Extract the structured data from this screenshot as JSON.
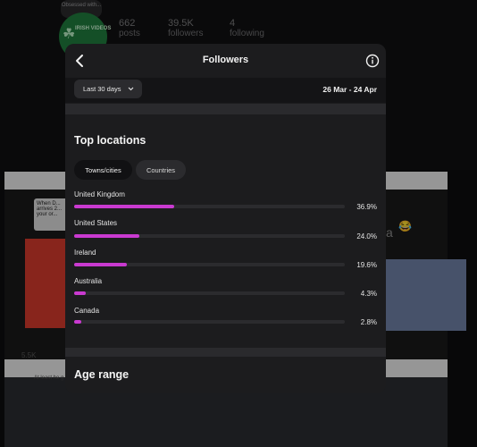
{
  "background": {
    "tag": "Obsessed with...",
    "avatar_label": "IRISH VIDEOS",
    "stats": [
      {
        "value": "662",
        "label": "posts"
      },
      {
        "value": "39.5K",
        "label": "followers"
      },
      {
        "value": "4",
        "label": "following"
      }
    ],
    "speech_text": "When D... arrives 2... your or...",
    "side_letter": "a",
    "side_emoji": "😂",
    "views_label": "5.5K",
    "bottom_caption": "At least he g..."
  },
  "modal": {
    "title": "Followers",
    "back_icon": "chevron-left-icon",
    "info_icon": "info-circle-icon",
    "range_label": "Last 30 days",
    "date_range": "26 Mar - 24 Apr",
    "top_locations": {
      "title": "Top locations",
      "tabs": [
        "Towns/cities",
        "Countries"
      ],
      "active_tab": "Towns/cities",
      "accent": "#c93ad0",
      "items": [
        {
          "name": "United Kingdom",
          "percent": "36.9%",
          "value": 36.9
        },
        {
          "name": "United States",
          "percent": "24.0%",
          "value": 24.0
        },
        {
          "name": "Ireland",
          "percent": "19.6%",
          "value": 19.6
        },
        {
          "name": "Australia",
          "percent": "4.3%",
          "value": 4.3
        },
        {
          "name": "Canada",
          "percent": "2.8%",
          "value": 2.8
        }
      ]
    },
    "age_range": {
      "title": "Age range"
    }
  }
}
